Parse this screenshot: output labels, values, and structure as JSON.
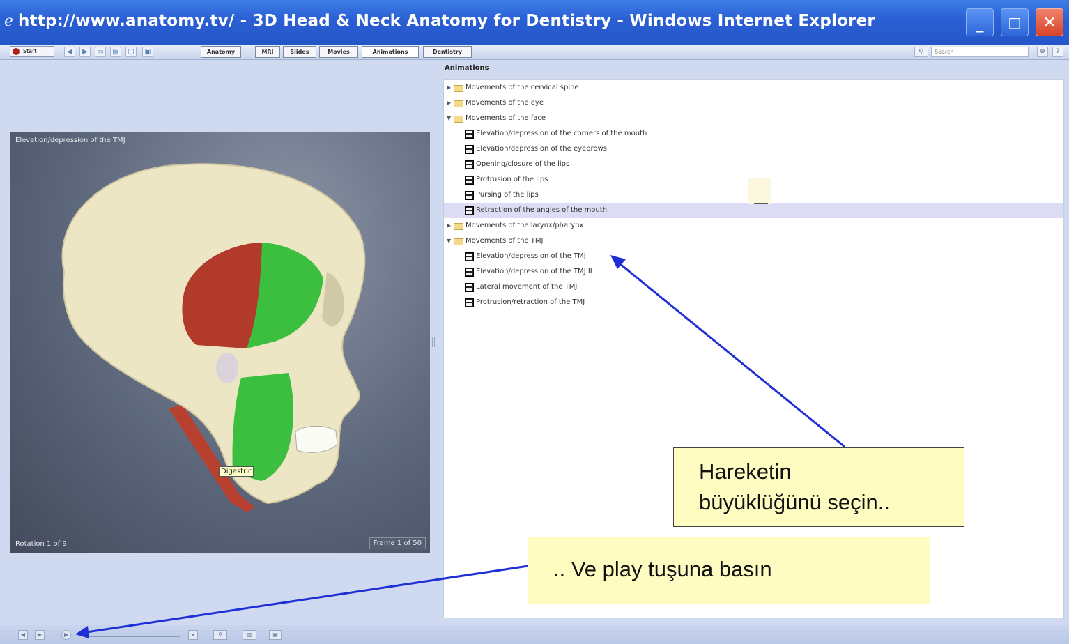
{
  "window": {
    "title": "http://www.anatomy.tv/ - 3D Head & Neck Anatomy for Dentistry - Windows Internet Explorer",
    "min_glyph": "_",
    "max_glyph": "□",
    "close_glyph": "✕"
  },
  "toolbar": {
    "start_label": "Start",
    "tabs": [
      "Anatomy",
      "MRI",
      "Slides",
      "Movies",
      "Animations",
      "Dentistry"
    ],
    "active_tab": "Animations",
    "search_placeholder": "Search"
  },
  "viewer": {
    "caption": "Elevation/depression of the TMJ",
    "rotation": "Rotation 1 of 9",
    "frame": "Frame 1 of 50",
    "tooltip": "Digastric",
    "colors": {
      "skull": "#ede6c4",
      "muscle_red": "#b23a2a",
      "muscle_green": "#3cbf3f"
    }
  },
  "panel": {
    "title": "Animations",
    "tree": [
      {
        "type": "folder",
        "expanded": false,
        "label": "Movements of the cervical spine"
      },
      {
        "type": "folder",
        "expanded": false,
        "label": "Movements of the eye"
      },
      {
        "type": "folder",
        "expanded": true,
        "label": "Movements of the face"
      },
      {
        "type": "item",
        "label": "Elevation/depression of the corners of the mouth"
      },
      {
        "type": "item",
        "label": "Elevation/depression of the eyebrows"
      },
      {
        "type": "item",
        "label": "Opening/closure of the lips"
      },
      {
        "type": "item",
        "label": "Protrusion of the lips"
      },
      {
        "type": "item",
        "label": "Pursing of the lips"
      },
      {
        "type": "item",
        "label": "Retraction of the angles of the mouth",
        "selected": true
      },
      {
        "type": "folder",
        "expanded": false,
        "label": "Movements of the larynx/pharynx"
      },
      {
        "type": "folder",
        "expanded": true,
        "label": "Movements of the TMJ"
      },
      {
        "type": "item",
        "label": "Elevation/depression of the TMJ"
      },
      {
        "type": "item",
        "label": "Elevation/depression of the TMJ II"
      },
      {
        "type": "item",
        "label": "Lateral movement of the TMJ"
      },
      {
        "type": "item",
        "label": "Protrusion/retraction of the TMJ"
      }
    ]
  },
  "callouts": {
    "size_line1": "Hareketin",
    "size_line2": "büyüklüğünü seçin..",
    "play": ".. Ve play tuşuna basın"
  },
  "accent_color": "#1f2fd6"
}
